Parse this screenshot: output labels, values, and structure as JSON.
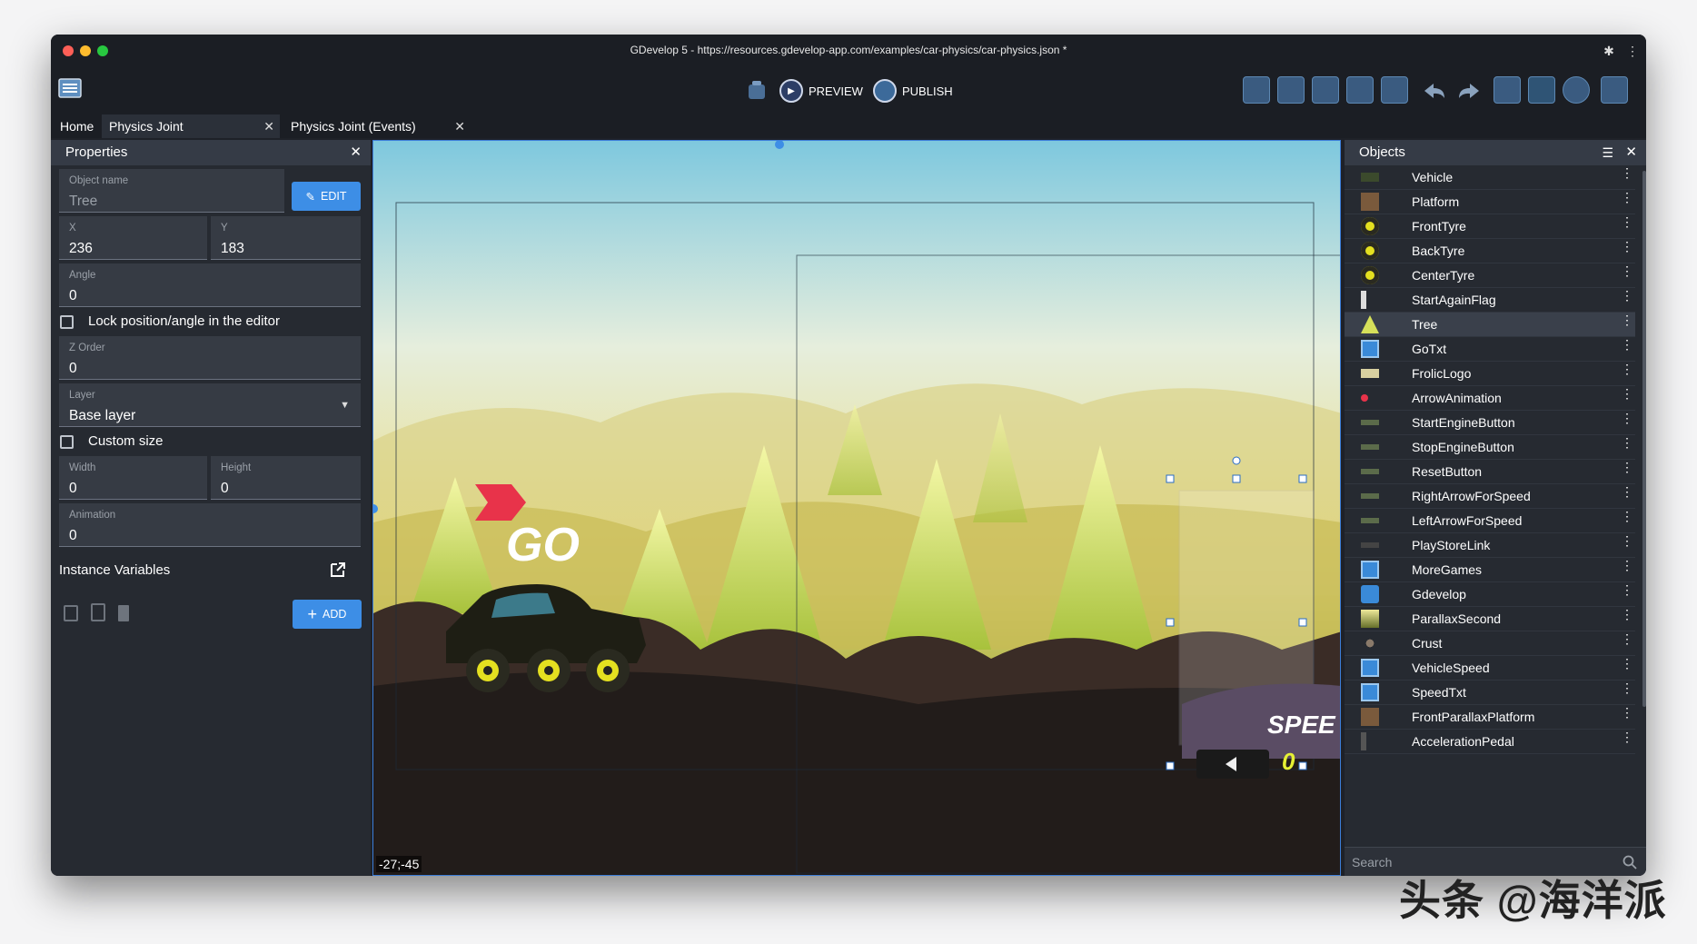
{
  "window": {
    "title": "GDevelop 5 - https://resources.gdevelop-app.com/examples/car-physics/car-physics.json *"
  },
  "toolbar": {
    "preview_label": "PREVIEW",
    "publish_label": "PUBLISH"
  },
  "tabs": [
    {
      "label": "Home"
    },
    {
      "label": "Physics Joint"
    },
    {
      "label": "Physics Joint (Events)"
    }
  ],
  "properties": {
    "title": "Properties",
    "object_name": {
      "label": "Object name",
      "value": "Tree"
    },
    "edit_label": "EDIT",
    "x": {
      "label": "X",
      "value": "236"
    },
    "y": {
      "label": "Y",
      "value": "183"
    },
    "angle": {
      "label": "Angle",
      "value": "0"
    },
    "lock_label": "Lock position/angle in the editor",
    "zorder": {
      "label": "Z Order",
      "value": "0"
    },
    "layer": {
      "label": "Layer",
      "value": "Base layer"
    },
    "custom_size_label": "Custom size",
    "width": {
      "label": "Width",
      "value": "0"
    },
    "height": {
      "label": "Height",
      "value": "0"
    },
    "animation": {
      "label": "Animation",
      "value": "0"
    },
    "instance_vars_label": "Instance Variables",
    "add_label": "ADD"
  },
  "canvas": {
    "coords": "-27;-45",
    "go_text": "GO",
    "speed_text": "SPEE",
    "speed_value": "0"
  },
  "objects": {
    "title": "Objects",
    "items": [
      {
        "name": "Vehicle",
        "icon": "vehicle-icon"
      },
      {
        "name": "Platform",
        "icon": "platform-icon"
      },
      {
        "name": "FrontTyre",
        "icon": "tyre-icon"
      },
      {
        "name": "BackTyre",
        "icon": "tyre-icon"
      },
      {
        "name": "CenterTyre",
        "icon": "tyre-icon"
      },
      {
        "name": "StartAgainFlag",
        "icon": "flag-icon"
      },
      {
        "name": "Tree",
        "icon": "tree-icon"
      },
      {
        "name": "GoTxt",
        "icon": "text-icon"
      },
      {
        "name": "FrolicLogo",
        "icon": "logo-icon"
      },
      {
        "name": "ArrowAnimation",
        "icon": "arrow-icon"
      },
      {
        "name": "StartEngineButton",
        "icon": "button-icon"
      },
      {
        "name": "StopEngineButton",
        "icon": "button-icon"
      },
      {
        "name": "ResetButton",
        "icon": "button-icon"
      },
      {
        "name": "RightArrowForSpeed",
        "icon": "button-icon"
      },
      {
        "name": "LeftArrowForSpeed",
        "icon": "button-icon"
      },
      {
        "name": "PlayStoreLink",
        "icon": "link-icon"
      },
      {
        "name": "MoreGames",
        "icon": "text-icon"
      },
      {
        "name": "Gdevelop",
        "icon": "gdevelop-icon"
      },
      {
        "name": "ParallaxSecond",
        "icon": "parallax-icon"
      },
      {
        "name": "Crust",
        "icon": "crust-icon"
      },
      {
        "name": "VehicleSpeed",
        "icon": "text-icon"
      },
      {
        "name": "SpeedTxt",
        "icon": "text-icon"
      },
      {
        "name": "FrontParallaxPlatform",
        "icon": "platform-icon"
      },
      {
        "name": "AccelerationPedal",
        "icon": "pedal-icon"
      }
    ],
    "search_placeholder": "Search"
  },
  "watermark": "头条 @海洋派",
  "colors": {
    "accent": "#3d8ee6",
    "panel": "#262a31",
    "header": "#353b46"
  }
}
